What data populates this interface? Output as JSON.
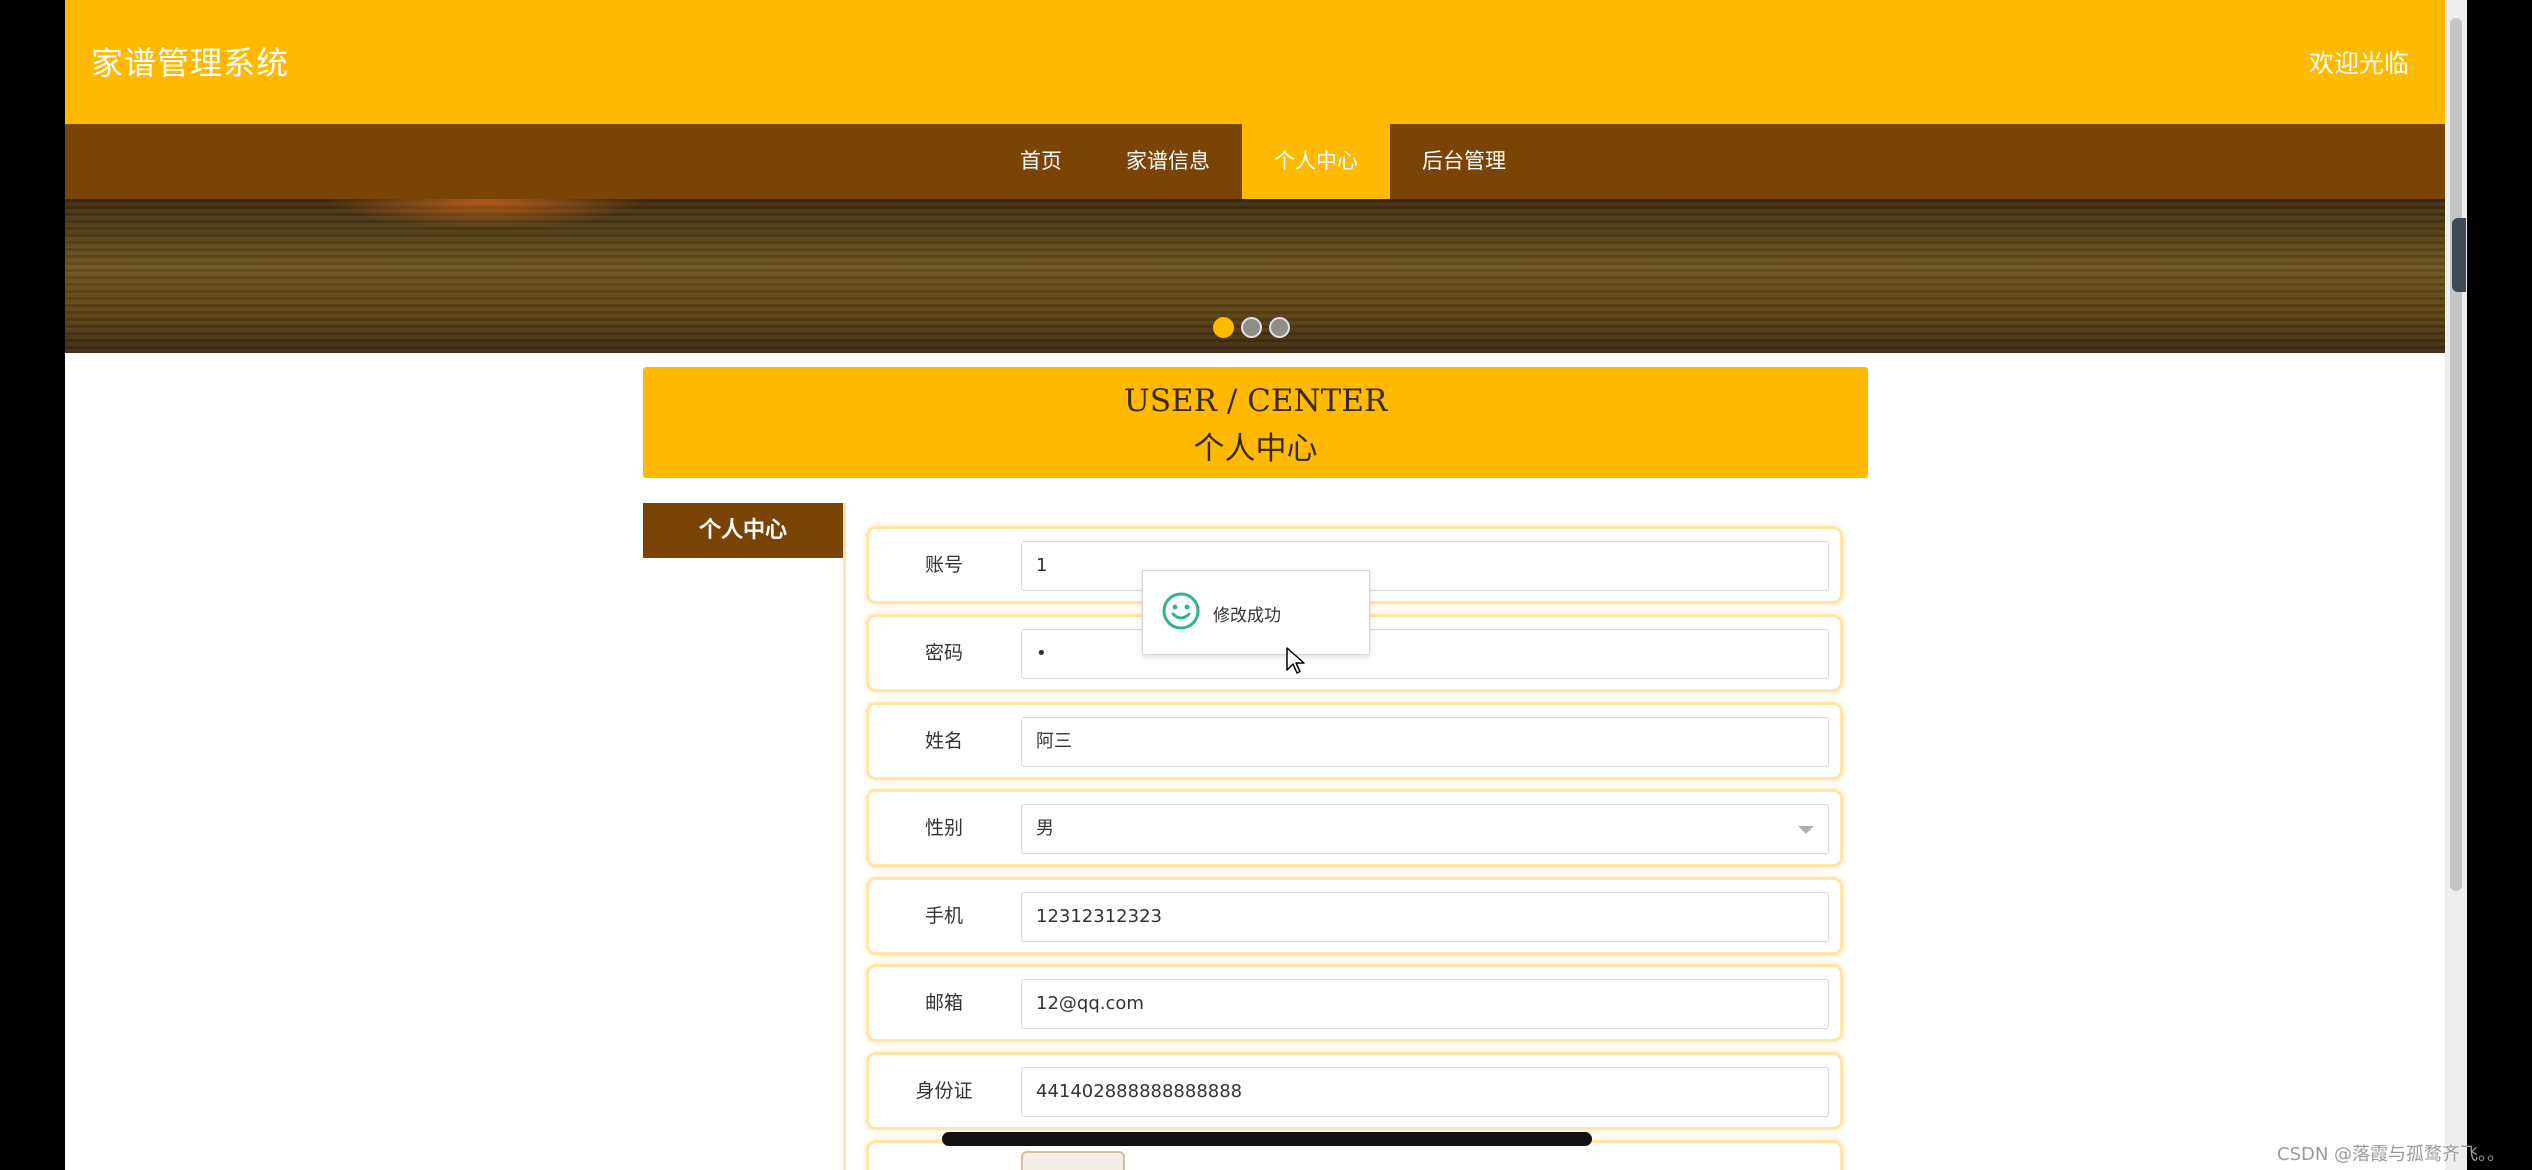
{
  "header": {
    "site_title": "家谱管理系统",
    "welcome": "欢迎光临"
  },
  "nav": {
    "items": [
      {
        "label": "首页",
        "active": false
      },
      {
        "label": "家谱信息",
        "active": false
      },
      {
        "label": "个人中心",
        "active": true
      },
      {
        "label": "后台管理",
        "active": false
      }
    ]
  },
  "banner": {
    "slides_total": 3,
    "active_slide": 1
  },
  "section": {
    "title_en": "USER / CENTER",
    "title_cn": "个人中心"
  },
  "sidebar": {
    "items": [
      {
        "label": "个人中心",
        "active": true
      }
    ]
  },
  "form": {
    "fields": [
      {
        "label": "账号",
        "value": "1"
      },
      {
        "label": "密码",
        "value": "•"
      },
      {
        "label": "姓名",
        "value": "阿三"
      },
      {
        "label": "性别",
        "value": "男"
      },
      {
        "label": "手机",
        "value": "12312312323"
      },
      {
        "label": "邮箱",
        "value": "12@qq.com"
      },
      {
        "label": "身份证",
        "value": "441402888888888888"
      }
    ]
  },
  "toast": {
    "message": "修改成功",
    "icon": "smile-icon"
  },
  "watermark": "CSDN @落霞与孤鹜齐飞。。",
  "colors": {
    "primary": "#FFBA00",
    "nav_bg": "#7B4407",
    "field_border": "#FFE6A6",
    "toast_icon": "#2FB58A"
  }
}
